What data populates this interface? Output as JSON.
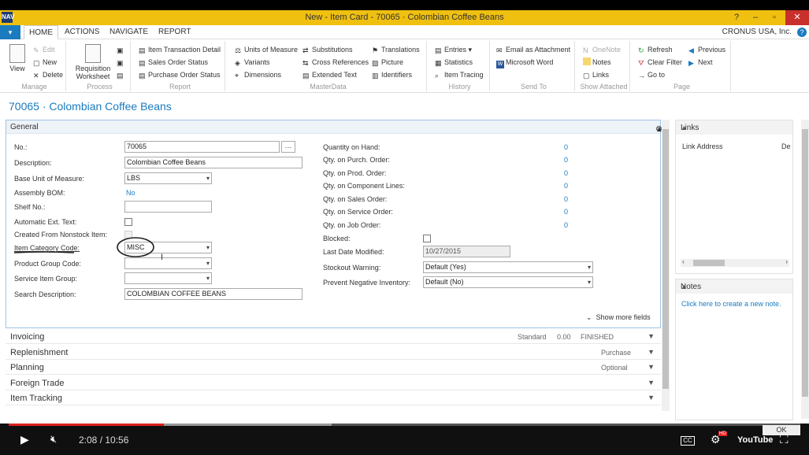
{
  "window": {
    "title": "New - Item Card - 70065 · Colombian Coffee Beans",
    "logo": "NAV"
  },
  "menu": {
    "app_button": "▾",
    "tabs": [
      "HOME",
      "ACTIONS",
      "NAVIGATE",
      "REPORT"
    ],
    "company": "CRONUS USA, Inc.",
    "help": "?"
  },
  "ribbon": {
    "manage": {
      "label": "Manage",
      "view": "View",
      "edit": "Edit",
      "new": "New",
      "delete": "Delete"
    },
    "process": {
      "label": "Process",
      "req": "Requisition",
      "req2": "Worksheet"
    },
    "report": {
      "label": "Report",
      "items": [
        "Item Transaction Detail",
        "Sales Order Status",
        "Purchase Order Status"
      ]
    },
    "masterdata": {
      "label": "MasterData",
      "items": [
        "Units of Measure",
        "Variants",
        "Dimensions",
        "Substitutions",
        "Cross References",
        "Extended Text",
        "Translations",
        "Picture",
        "Identifiers"
      ]
    },
    "history": {
      "label": "History",
      "items": [
        "Entries ▾",
        "Statistics",
        "Item Tracing"
      ]
    },
    "sendto": {
      "label": "Send To",
      "items": [
        "Email as Attachment",
        "Microsoft Word"
      ]
    },
    "attached": {
      "label": "Show Attached",
      "items": [
        "OneNote",
        "Notes",
        "Links"
      ]
    },
    "page": {
      "label": "Page",
      "items": [
        "Refresh",
        "Clear Filter",
        "Go to",
        "Previous",
        "Next"
      ]
    }
  },
  "page_title": "70065 · Colombian Coffee Beans",
  "general": {
    "header": "General",
    "left": {
      "no_label": "No.:",
      "no_value": "70065",
      "desc_label": "Description:",
      "desc_value": "Colombian Coffee Beans",
      "uom_label": "Base Unit of Measure:",
      "uom_value": "LBS",
      "bom_label": "Assembly BOM:",
      "bom_value": "No",
      "shelf_label": "Shelf No.:",
      "ext_label": "Automatic Ext. Text:",
      "nonstock_label": "Created From Nonstock Item:",
      "cat_label": "Item Category Code:",
      "cat_value": "MISC",
      "pgc_label": "Product Group Code:",
      "sig_label": "Service Item Group:",
      "search_label": "Search Description:",
      "search_value": "COLOMBIAN COFFEE BEANS"
    },
    "right": {
      "qoh_label": "Quantity on Hand:",
      "qoh": "0",
      "qpo_label": "Qty. on Purch. Order:",
      "qpo": "0",
      "qprod_label": "Qty. on Prod. Order:",
      "qprod": "0",
      "qcomp_label": "Qty. on Component Lines:",
      "qcomp": "0",
      "qso_label": "Qty. on Sales Order:",
      "qso": "0",
      "qsvc_label": "Qty. on Service Order:",
      "qsvc": "0",
      "qjob_label": "Qty. on Job Order:",
      "qjob": "0",
      "blocked_label": "Blocked:",
      "lmod_label": "Last Date Modified:",
      "lmod": "10/27/2015",
      "stock_label": "Stockout Warning:",
      "stock": "Default (Yes)",
      "neg_label": "Prevent Negative Inventory:",
      "neg": "Default (No)"
    },
    "more": "Show more fields"
  },
  "fasttabs": {
    "invoicing": {
      "title": "Invoicing",
      "s1": "Standard",
      "s2": "0.00",
      "s3": "FINISHED"
    },
    "replenishment": {
      "title": "Replenishment",
      "s1": "Purchase"
    },
    "planning": {
      "title": "Planning",
      "s1": "Optional"
    },
    "foreign": {
      "title": "Foreign Trade"
    },
    "tracking": {
      "title": "Item Tracking"
    }
  },
  "links": {
    "title": "Links",
    "col1": "Link Address",
    "col2": "De"
  },
  "notes": {
    "title": "Notes",
    "link": "Click here to create a new note."
  },
  "player": {
    "time": "2:08 / 10:56",
    "progress": 0.196,
    "buffered": 0.408,
    "cc": "CC",
    "hd": "HD",
    "yt": "YouTube",
    "ok": "OK"
  },
  "colors": {
    "accent": "#1a7bbf",
    "titlebar": "#f0c010",
    "progress": "#e02020"
  }
}
